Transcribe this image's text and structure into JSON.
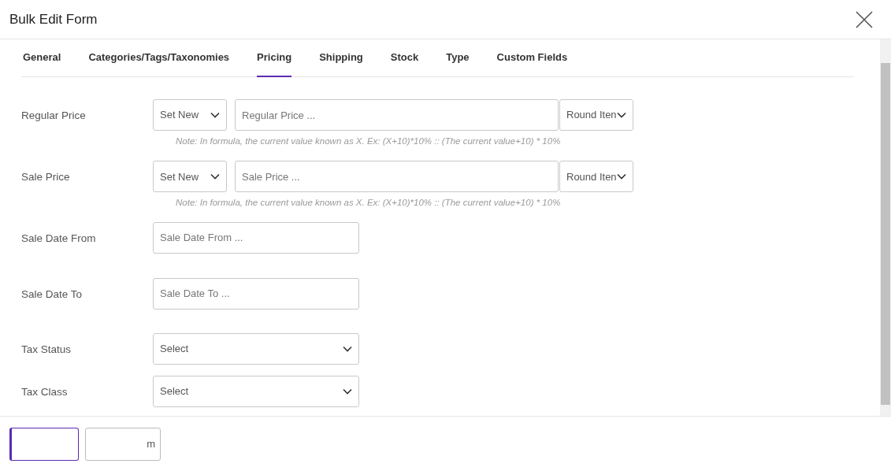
{
  "window": {
    "title": "Bulk Edit Form"
  },
  "tabs": [
    {
      "label": "General",
      "selected": false
    },
    {
      "label": "Categories/Tags/Taxonomies",
      "selected": false
    },
    {
      "label": "Pricing",
      "selected": true
    },
    {
      "label": "Shipping",
      "selected": false
    },
    {
      "label": "Stock",
      "selected": false
    },
    {
      "label": "Type",
      "selected": false
    },
    {
      "label": "Custom Fields",
      "selected": false
    }
  ],
  "fields": [
    {
      "kind": "price",
      "label": "Regular Price",
      "operator": "Set New",
      "placeholder": "Regular Price ...",
      "rounding": "Round Iten",
      "note": "Note: In formula, the current value known as X. Ex: (X+10)*10% :: (The current value+10) * 10%"
    },
    {
      "kind": "price",
      "label": "Sale Price",
      "operator": "Set New",
      "placeholder": "Sale Price ...",
      "rounding": "Round Iten",
      "note": "Note: In formula, the current value known as X. Ex: (X+10)*10% :: (The current value+10) * 10%"
    },
    {
      "kind": "date",
      "label": "Sale Date From",
      "placeholder": "Sale Date From ..."
    },
    {
      "kind": "date",
      "label": "Sale Date To",
      "placeholder": "Sale Date To ..."
    },
    {
      "kind": "select",
      "label": "Tax Status",
      "value": "Select"
    },
    {
      "kind": "select",
      "label": "Tax Class",
      "value": "Select"
    }
  ],
  "footer_buttons": [
    {
      "kind": "primary"
    },
    {
      "kind": "outline",
      "label": "m"
    }
  ]
}
